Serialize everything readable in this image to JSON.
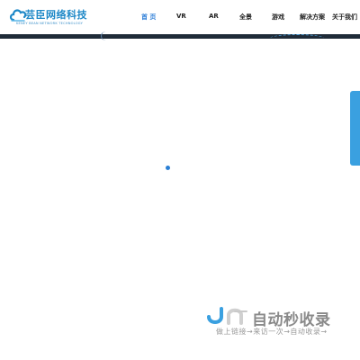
{
  "header": {
    "logo": {
      "name": "芸臣网络科技",
      "subtitle": "KENEY BEAN NETWORK TECHNOLOGY",
      "brand_color": "#1e88c7"
    },
    "nav": [
      {
        "label": "首 页",
        "active": true
      },
      {
        "label": "VR",
        "active": false
      },
      {
        "label": "AR",
        "active": false
      },
      {
        "label": "全景",
        "active": false
      },
      {
        "label": "游戏",
        "active": false
      },
      {
        "label": "解决方案",
        "active": false
      },
      {
        "label": "关于我们",
        "active": false
      }
    ],
    "active_color": "#2f7fd8"
  },
  "main": {
    "loader_color": "#2a7fd4",
    "side_tab_color": "#3aa0e0"
  },
  "watermark": {
    "title": "自动秒收录",
    "subtitle": "做上链接→来访一次→自动收录→"
  }
}
